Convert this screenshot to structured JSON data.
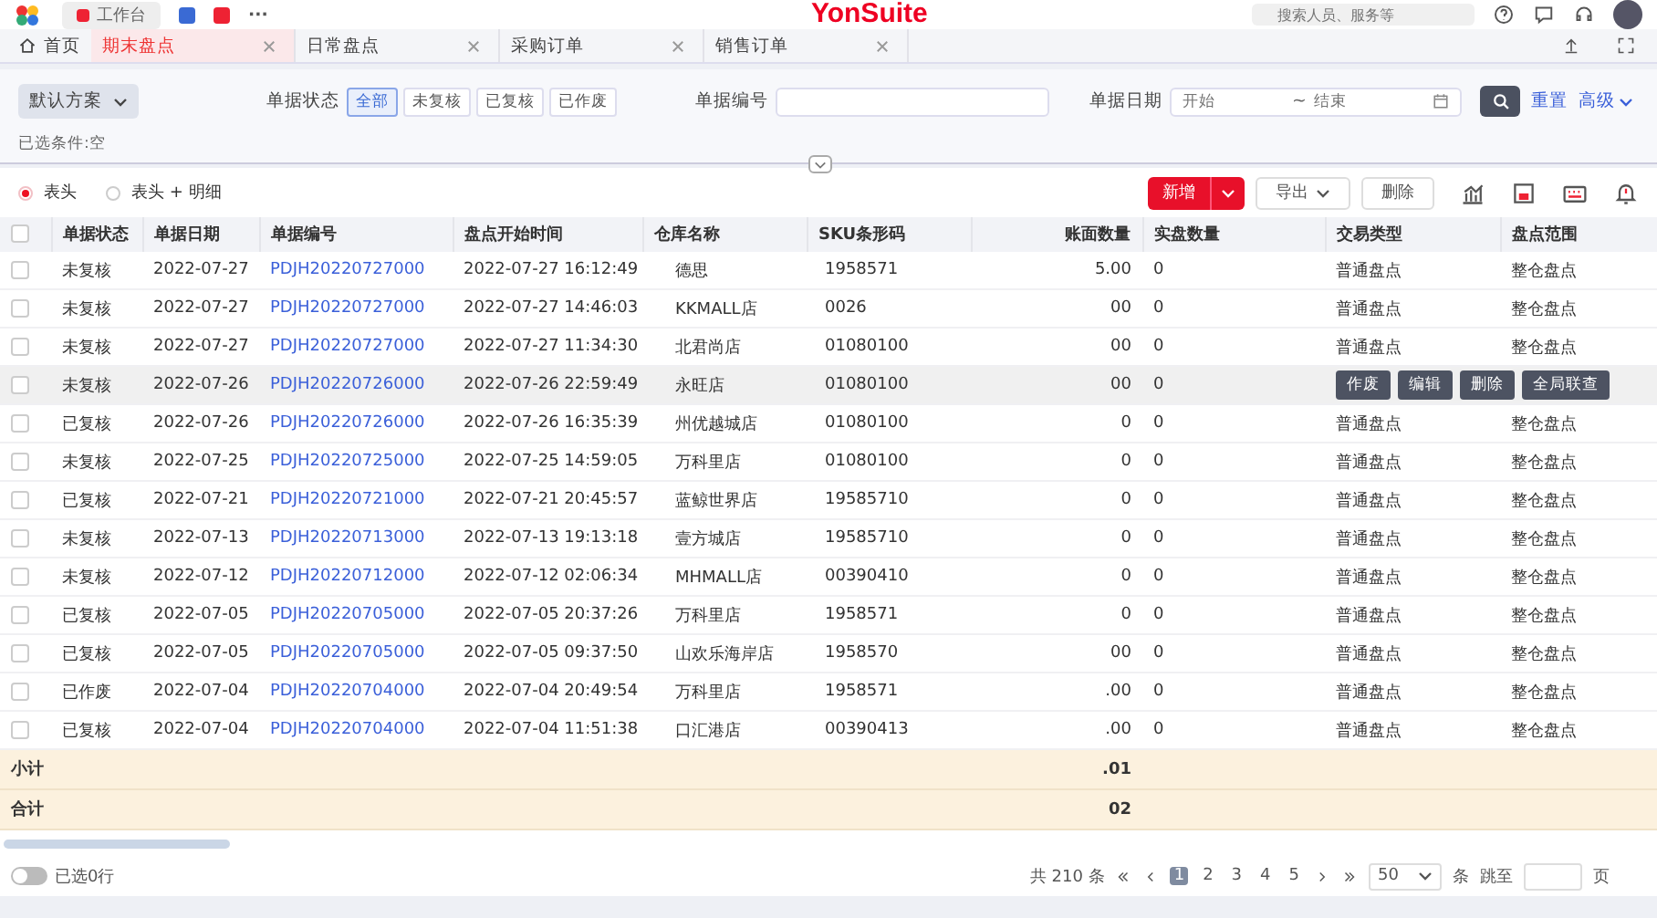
{
  "top_bar": {
    "workbench_tab": "工作台",
    "more": "···",
    "brand": "YonSuite",
    "search": {
      "placeholder": "搜索人员、服务等"
    }
  },
  "tabs": [
    {
      "label": "首页",
      "selected": false,
      "closable": false
    },
    {
      "label": "期末盘点",
      "selected": true,
      "closable": true
    },
    {
      "label": "日常盘点",
      "selected": false,
      "closable": true
    },
    {
      "label": "采购订单",
      "selected": false,
      "closable": true
    },
    {
      "label": "销售订单",
      "selected": false,
      "closable": true
    }
  ],
  "filter": {
    "scheme": "默认方案",
    "status_label": "单据状态",
    "status_options": [
      {
        "label": "全部",
        "selected": true
      },
      {
        "label": "未复核",
        "selected": false
      },
      {
        "label": "已复核",
        "selected": false
      },
      {
        "label": "已作废",
        "selected": false
      }
    ],
    "number_label": "单据编号",
    "date_label": "单据日期",
    "date_start": {
      "placeholder": "开始"
    },
    "date_sep": "~",
    "date_end": {
      "placeholder": "结束"
    },
    "reset": "重置",
    "advanced": "高级",
    "selected_conditions": "已选条件:空"
  },
  "view_options": [
    {
      "label": "表头",
      "selected": true
    },
    {
      "label": "表头 + 明细",
      "selected": false
    }
  ],
  "toolbar": {
    "add": "新增",
    "export": "导出",
    "delete": "删除"
  },
  "table": {
    "select_all_checked": false,
    "columns": [
      "单据状态",
      "单据日期",
      "单据编号",
      "盘点开始时间",
      "仓库名称",
      "SKU条形码",
      "账面数量",
      "实盘数量",
      "交易类型",
      "盘点范围"
    ],
    "rows": [
      {
        "status": "未复核",
        "date": "2022-07-27",
        "number": "PDJH20220727000",
        "start": "2022-07-27 16:12:49",
        "warehouse": "德思",
        "sku": "1958571",
        "book": "5.00",
        "actual": "0",
        "type": "普通盘点",
        "scope": "整仓盘点",
        "checked": false
      },
      {
        "status": "未复核",
        "date": "2022-07-27",
        "number": "PDJH20220727000",
        "start": "2022-07-27 14:46:03",
        "warehouse": "KKMALL店",
        "sku": "0026",
        "book": "00",
        "actual": "0",
        "type": "普通盘点",
        "scope": "整仓盘点",
        "checked": false
      },
      {
        "status": "未复核",
        "date": "2022-07-27",
        "number": "PDJH20220727000",
        "start": "2022-07-27 11:34:30",
        "warehouse": "北君尚店",
        "sku": "01080100",
        "book": "00",
        "actual": "0",
        "type": "普通盘点",
        "scope": "整仓盘点",
        "checked": false
      },
      {
        "status": "未复核",
        "date": "2022-07-26",
        "number": "PDJH20220726000",
        "start": "2022-07-26 22:59:49",
        "warehouse": "永旺店",
        "sku": "01080100",
        "book": "00",
        "actual": "0",
        "actions": [
          "作废",
          "编辑",
          "删除",
          "全局联查"
        ],
        "checked": false
      },
      {
        "status": "已复核",
        "date": "2022-07-26",
        "number": "PDJH20220726000",
        "start": "2022-07-26 16:35:39",
        "warehouse": "州优越城店",
        "sku": "01080100",
        "book": "0",
        "actual": "0",
        "type": "普通盘点",
        "scope": "整仓盘点",
        "checked": false
      },
      {
        "status": "未复核",
        "date": "2022-07-25",
        "number": "PDJH20220725000",
        "start": "2022-07-25 14:59:05",
        "warehouse": "万科里店",
        "sku": "01080100",
        "book": "0",
        "actual": "0",
        "type": "普通盘点",
        "scope": "整仓盘点",
        "checked": false
      },
      {
        "status": "已复核",
        "date": "2022-07-21",
        "number": "PDJH20220721000",
        "start": "2022-07-21 20:45:57",
        "warehouse": "蓝鲸世界店",
        "sku": "19585710",
        "book": "0",
        "actual": "0",
        "type": "普通盘点",
        "scope": "整仓盘点",
        "checked": false
      },
      {
        "status": "未复核",
        "date": "2022-07-13",
        "number": "PDJH20220713000",
        "start": "2022-07-13 19:13:18",
        "warehouse": "壹方城店",
        "sku": "19585710",
        "book": "0",
        "actual": "0",
        "type": "普通盘点",
        "scope": "整仓盘点",
        "checked": false
      },
      {
        "status": "未复核",
        "date": "2022-07-12",
        "number": "PDJH20220712000",
        "start": "2022-07-12 02:06:34",
        "warehouse": "MHMALL店",
        "sku": "00390410",
        "book": "0",
        "actual": "0",
        "type": "普通盘点",
        "scope": "整仓盘点",
        "checked": false
      },
      {
        "status": "已复核",
        "date": "2022-07-05",
        "number": "PDJH20220705000",
        "start": "2022-07-05 20:37:26",
        "warehouse": "万科里店",
        "sku": "1958571",
        "book": "0",
        "actual": "0",
        "type": "普通盘点",
        "scope": "整仓盘点",
        "checked": false
      },
      {
        "status": "已复核",
        "date": "2022-07-05",
        "number": "PDJH20220705000",
        "start": "2022-07-05 09:37:50",
        "warehouse": "山欢乐海岸店",
        "sku": "1958570",
        "book": "00",
        "actual": "0",
        "type": "普通盘点",
        "scope": "整仓盘点",
        "checked": false
      },
      {
        "status": "已作废",
        "date": "2022-07-04",
        "number": "PDJH20220704000",
        "start": "2022-07-04 20:49:54",
        "warehouse": "万科里店",
        "sku": "1958571",
        "book": ".00",
        "actual": "0",
        "type": "普通盘点",
        "scope": "整仓盘点",
        "checked": false
      },
      {
        "status": "已复核",
        "date": "2022-07-04",
        "number": "PDJH20220704000",
        "start": "2022-07-04 11:51:38",
        "warehouse": "口汇港店",
        "sku": "00390413",
        "book": ".00",
        "actual": "0",
        "type": "普通盘点",
        "scope": "整仓盘点",
        "checked": false
      }
    ],
    "totals": [
      {
        "label": "小计",
        "book": ".01"
      },
      {
        "label": "合计",
        "book": "02"
      }
    ]
  },
  "footer": {
    "selected_toggle": {
      "label": "已选0行",
      "on": false
    },
    "total": "共 210 条",
    "pages": [
      {
        "label": "1",
        "selected": true
      },
      {
        "label": "2",
        "selected": false
      },
      {
        "label": "3",
        "selected": false
      },
      {
        "label": "4",
        "selected": false
      },
      {
        "label": "5",
        "selected": false
      }
    ],
    "page_size": "50",
    "page_size_unit": "条",
    "jump_label": "跳至",
    "page_unit": "页"
  }
}
